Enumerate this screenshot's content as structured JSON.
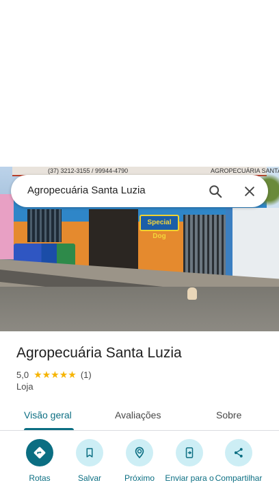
{
  "search": {
    "query": "Agropecuária Santa Luzia"
  },
  "photo": {
    "sign_phone": "(37) 3212-3155 / 99944-4790",
    "sign_name": "AGROPECUÁRIA SANTA",
    "sign_brand": "Special Dog",
    "sign_phone_mid": "3212-3155"
  },
  "place": {
    "title": "Agropecuária Santa Luzia",
    "rating": "5,0",
    "stars": "★★★★★",
    "review_count": "(1)",
    "category": "Loja"
  },
  "tabs": [
    {
      "label": "Visão geral",
      "active": true
    },
    {
      "label": "Avaliações",
      "active": false
    },
    {
      "label": "Sobre",
      "active": false
    }
  ],
  "actions": [
    {
      "label": "Rotas",
      "icon": "directions-icon"
    },
    {
      "label": "Salvar",
      "icon": "bookmark-icon"
    },
    {
      "label": "Próximo",
      "icon": "nearby-icon"
    },
    {
      "label": "Enviar para o",
      "icon": "send-to-phone-icon"
    },
    {
      "label": "Compartilhar",
      "icon": "share-icon"
    }
  ],
  "colors": {
    "accent": "#0b6e82",
    "accent_light": "#cdeef5",
    "star": "#f6b400"
  }
}
